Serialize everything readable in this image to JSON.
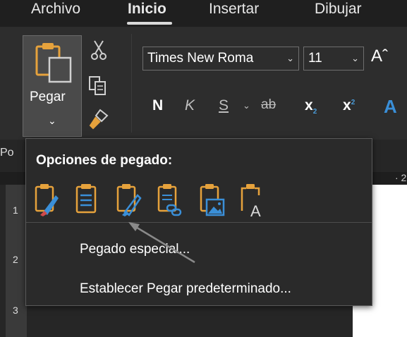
{
  "tabs": [
    {
      "label": "Archivo"
    },
    {
      "label": "Inicio"
    },
    {
      "label": "Insertar"
    },
    {
      "label": "Dibujar"
    }
  ],
  "clipboard": {
    "paste_label": "Pegar",
    "group_label_partial": "Po"
  },
  "font": {
    "name": "Times New Roma",
    "size": "11"
  },
  "format_buttons": {
    "bold": "N",
    "italic": "K",
    "underline": "S",
    "strike": "ab",
    "subscript": "x",
    "superscript": "x",
    "text_effects": "A"
  },
  "ruler": {
    "top_tick": "· 2",
    "left_numbers": [
      "1",
      "2",
      "3"
    ]
  },
  "paste_menu": {
    "header": "Opciones de pegado:",
    "options": [
      {
        "icon": "keep-source-formatting-icon"
      },
      {
        "icon": "merge-formatting-icon"
      },
      {
        "icon": "use-destination-styles-icon"
      },
      {
        "icon": "link-keep-formatting-icon"
      },
      {
        "icon": "picture-icon"
      },
      {
        "icon": "keep-text-only-icon"
      }
    ],
    "items": [
      {
        "label": "Pegado especial..."
      },
      {
        "label": "Establecer Pegar predeterminado..."
      }
    ]
  },
  "colors": {
    "accent_blue": "#3a8fd8",
    "clipboard_orange": "#e6a23c",
    "menu_bg": "#2a2a2a"
  }
}
